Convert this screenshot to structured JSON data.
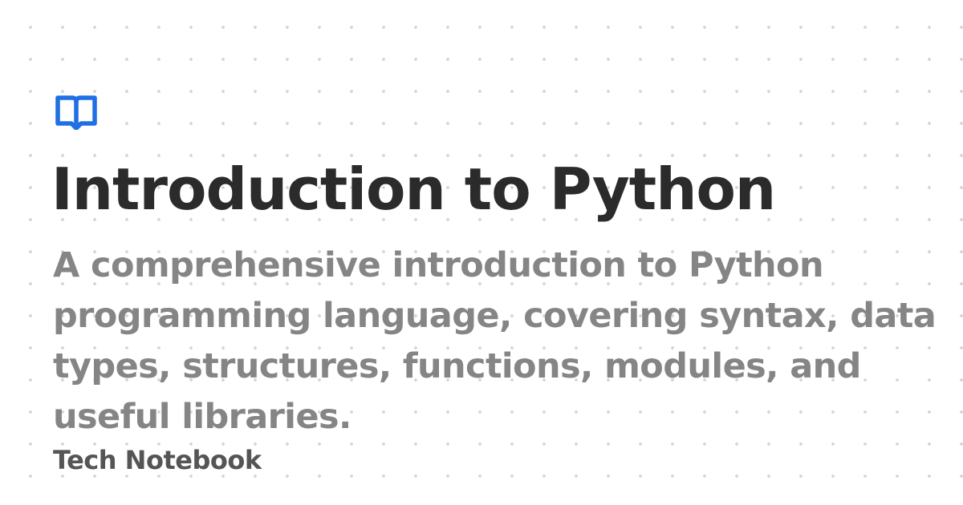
{
  "card": {
    "logo_icon": "open-book-icon",
    "title": "Introduction to Python",
    "description": "A comprehensive introduction to Python programming language, covering syntax, data types, structures, functions, modules, and useful libraries.",
    "site_name": "Tech Notebook"
  },
  "colors": {
    "accent": "#1f6fe5",
    "title": "#2b2b2b",
    "description": "#858585",
    "site_name": "#555555",
    "background": "#ffffff",
    "dots": "#d4d4d4"
  }
}
